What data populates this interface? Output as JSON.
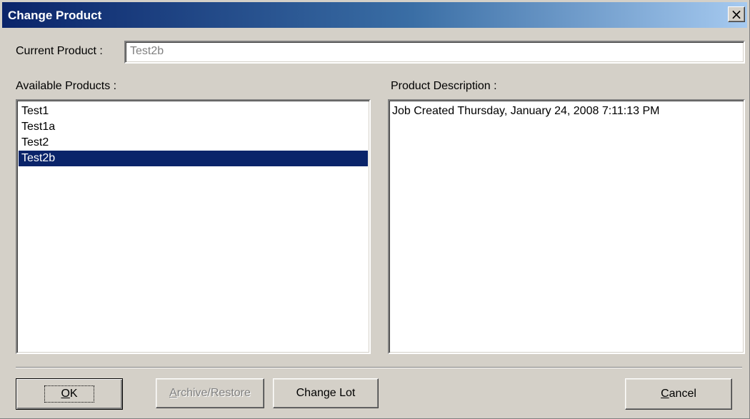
{
  "window": {
    "title": "Change Product",
    "close_symbol": "×"
  },
  "current_product": {
    "label": "Current Product :",
    "value": "Test2b"
  },
  "available_products": {
    "label": "Available Products :",
    "items": [
      {
        "label": "Test1",
        "selected": false
      },
      {
        "label": "Test1a",
        "selected": false
      },
      {
        "label": "Test2",
        "selected": false
      },
      {
        "label": "Test2b",
        "selected": true
      }
    ]
  },
  "product_description": {
    "label": "Product Description :",
    "text": "Job Created Thursday, January 24, 2008 7:11:13 PM"
  },
  "buttons": {
    "ok": {
      "mnemonic": "O",
      "rest": "K"
    },
    "archive_restore": {
      "mnemonic": "A",
      "rest": "rchive/Restore"
    },
    "change_lot": {
      "label": "Change Lot"
    },
    "cancel": {
      "mnemonic": "C",
      "rest": "ancel"
    }
  },
  "colors": {
    "face": "#d4d0c8",
    "selection": "#0a246a",
    "title_start": "#0a246a",
    "title_end": "#a6caf0"
  }
}
